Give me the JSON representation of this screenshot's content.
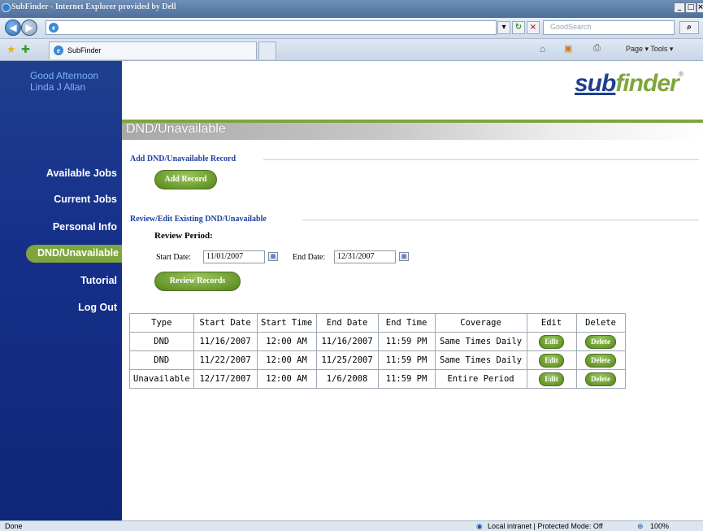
{
  "browser": {
    "window_title": "SubFinder - Internet Explorer provided by Dell",
    "address": "",
    "search_placeholder": "GoodSearch",
    "tab_title": "SubFinder",
    "toolbar_right": "Page ▾  Tools ▾",
    "status_left": "Done",
    "status_zone": "Local intranet | Protected Mode: Off",
    "zoom": "100%"
  },
  "sidebar": {
    "greeting": "Good Afternoon",
    "user": "Linda J Allan",
    "items": [
      {
        "label": "Available Jobs"
      },
      {
        "label": "Current Jobs"
      },
      {
        "label": "Personal Info"
      },
      {
        "label": "DND/Unavailable"
      },
      {
        "label": "Tutorial"
      },
      {
        "label": "Log Out"
      }
    ]
  },
  "logo": {
    "part1": "sub",
    "part2": "finder",
    "mark": "®"
  },
  "page": {
    "title": "DND/Unavailable",
    "add_section": "Add DND/Unavailable Record",
    "add_button": "Add Record",
    "review_section": "Review/Edit Existing DND/Unavailable",
    "review_period": "Review Period:",
    "start_label": "Start Date:",
    "start_value": "11/01/2007",
    "end_label": "End Date:",
    "end_value": "12/31/2007",
    "review_button": "Review Records"
  },
  "table": {
    "headers": [
      "Type",
      "Start Date",
      "Start Time",
      "End Date",
      "End Time",
      "Coverage",
      "Edit",
      "Delete"
    ],
    "rows": [
      [
        "DND",
        "11/16/2007",
        "12:00 AM",
        "11/16/2007",
        "11:59 PM",
        "Same Times Daily",
        "Edit",
        "Delete"
      ],
      [
        "DND",
        "11/22/2007",
        "12:00 AM",
        "11/25/2007",
        "11:59 PM",
        "Same Times Daily",
        "Edit",
        "Delete"
      ],
      [
        "Unavailable",
        "12/17/2007",
        "12:00 AM",
        "1/6/2008",
        "11:59 PM",
        "Entire Period",
        "Edit",
        "Delete"
      ]
    ]
  },
  "colors": {
    "sidebar": "#16308a",
    "accent_green": "#7ea53e",
    "section_blue": "#1f3f9e"
  }
}
